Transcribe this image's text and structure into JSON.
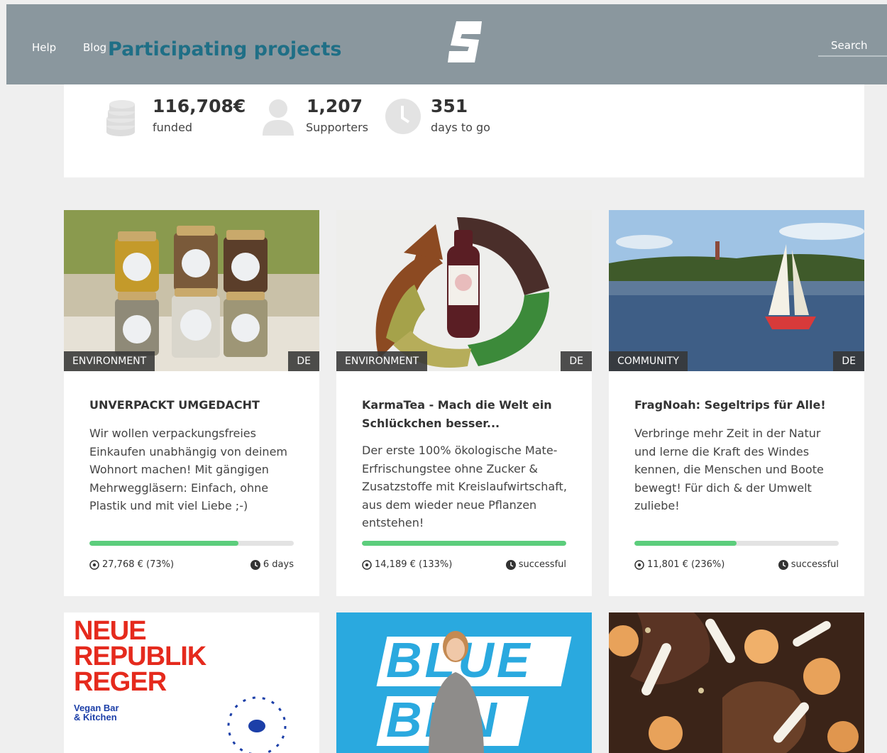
{
  "header": {
    "help": "Help",
    "blog": "Blog",
    "title": "Participating projects",
    "search_placeholder": "Search"
  },
  "stats": [
    {
      "value": "116,708€",
      "label": "funded",
      "icon": "coins-icon"
    },
    {
      "value": "1,207",
      "label": "Supporters",
      "icon": "person-icon"
    },
    {
      "value": "351",
      "label": "days to go",
      "icon": "clock-icon"
    }
  ],
  "cards": [
    {
      "category": "ENVIRONMENT",
      "country": "DE",
      "title": "UNVERPACKT UMGEDACHT",
      "description": "Wir wollen verpackungsfreies Einkaufen unabhängig von deinem Wohnort machen! Mit gängigen Mehrweggläsern: Einfach, ohne Plastik und mit viel Liebe ;-)",
      "funded": "27,768 € (73%)",
      "progress": 0.73,
      "status": "6 days"
    },
    {
      "category": "ENVIRONMENT",
      "country": "DE",
      "title": "KarmaTea - Mach die Welt ein Schlückchen besser...",
      "description": "Der erste 100% ökologische Mate-Erfrischungstee ohne Zucker & Zusatzstoffe mit Kreislaufwirtschaft, aus dem wieder neue Pflanzen entstehen!",
      "funded": "14,189 € (133%)",
      "progress": 1.0,
      "status": "successful"
    },
    {
      "category": "COMMUNITY",
      "country": "DE",
      "title": "FragNoah: Segeltrips für Alle!",
      "description": "Verbringe mehr Zeit in der Natur und lerne die Kraft des Windes kennen, die Menschen und Boote bewegt! Für dich & der Umwelt zuliebe!",
      "funded": "11,801 € (236%)",
      "progress": 0.5,
      "status": "successful"
    }
  ],
  "row2": {
    "poster_line1": "NEUE",
    "poster_line2": "REPUBLIK",
    "poster_line3": "REGER",
    "poster_sub1": "Vegan Bar",
    "poster_sub2": "& Kitchen",
    "blue_text1": "BLUE",
    "blue_text2": "BEN"
  },
  "colors": {
    "header_bg": "#8a979e",
    "title": "#1f6f86",
    "progress": "#5ccd7c",
    "poster_red": "#e52a1d",
    "blue_bg": "#2aa9df"
  }
}
